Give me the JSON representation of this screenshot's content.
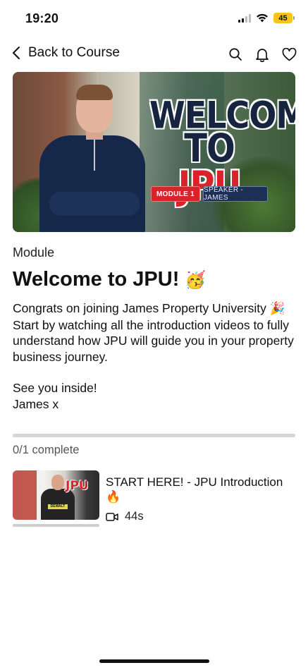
{
  "status_bar": {
    "time": "19:20",
    "battery": "45",
    "battery_color": "#f5c518"
  },
  "header": {
    "back_label": "Back to Course",
    "actions": [
      {
        "icon": "search-icon"
      },
      {
        "icon": "bell-icon"
      },
      {
        "icon": "heart-icon"
      }
    ]
  },
  "banner": {
    "title_line1": "WELCOME",
    "title_line2_prefix": "TO ",
    "title_line2_highlight": "JPU",
    "tag_module": "MODULE 1",
    "tag_speaker": "SPEAKER - JAMES",
    "accent_color": "#d9222a"
  },
  "module": {
    "label": "Module",
    "title": "Welcome to JPU!",
    "title_emoji": "🥳",
    "description_line1": "Congrats on joining James Property University",
    "description_emoji": "🎉",
    "description_line2": "Start by watching all the introduction videos to fully understand how JPU will guide you in your property business journey.",
    "sign_off_line1": "See you inside!",
    "sign_off_line2": "James x"
  },
  "progress": {
    "text": "0/1 complete",
    "completed": 0,
    "total": 1,
    "fraction": 0
  },
  "lessons": [
    {
      "title": "START HERE! - JPU Introduction",
      "title_emoji": "🔥",
      "duration": "44s",
      "thumb_text": "JPU",
      "thumb_logo": "DEWALT",
      "watched_fraction": 0
    }
  ]
}
